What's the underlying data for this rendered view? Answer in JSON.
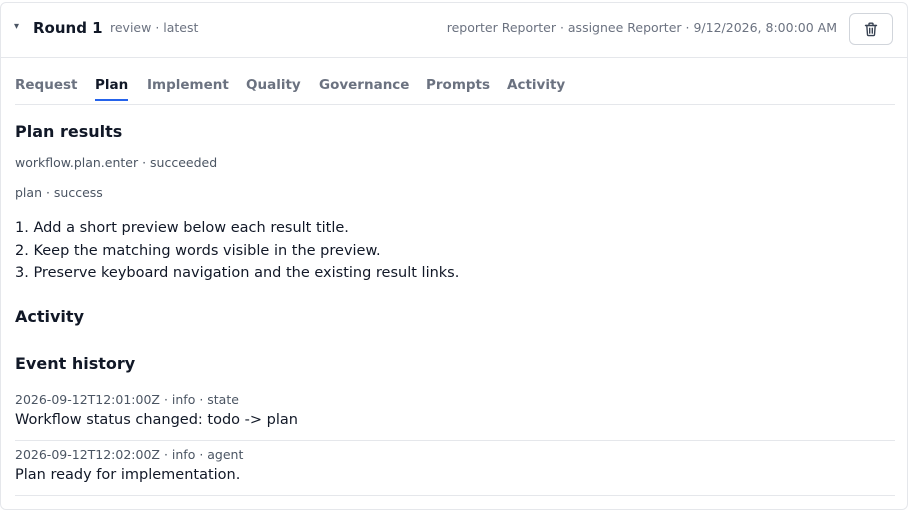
{
  "header": {
    "collapse_icon": "chevron-down-icon",
    "title": "Round 1",
    "meta": "review · latest",
    "people": "reporter Reporter · assignee Reporter · 9/12/2026, 8:00:00 AM",
    "delete_icon": "trash-icon"
  },
  "tabs": [
    {
      "label": "Request",
      "active": false
    },
    {
      "label": "Plan",
      "active": true
    },
    {
      "label": "Implement",
      "active": false
    },
    {
      "label": "Quality",
      "active": false
    },
    {
      "label": "Governance",
      "active": false
    },
    {
      "label": "Prompts",
      "active": false
    },
    {
      "label": "Activity",
      "active": false
    }
  ],
  "plan": {
    "title": "Plan results",
    "workflow_status": "workflow.plan.enter · succeeded",
    "result_status": "plan · success",
    "steps": [
      "1. Add a short preview below each result title.",
      "2. Keep the matching words visible in the preview.",
      "3. Preserve keyboard navigation and the existing result links."
    ]
  },
  "activity": {
    "title": "Activity",
    "history_title": "Event history",
    "events": [
      {
        "meta": "2026-09-12T12:01:00Z · info · state",
        "message": "Workflow status changed: todo -> plan"
      },
      {
        "meta": "2026-09-12T12:02:00Z · info · agent",
        "message": "Plan ready for implementation."
      }
    ]
  },
  "colors": {
    "accent": "#2563eb",
    "border": "#e5e7eb",
    "muted_text": "#6b7280",
    "text": "#111827"
  }
}
